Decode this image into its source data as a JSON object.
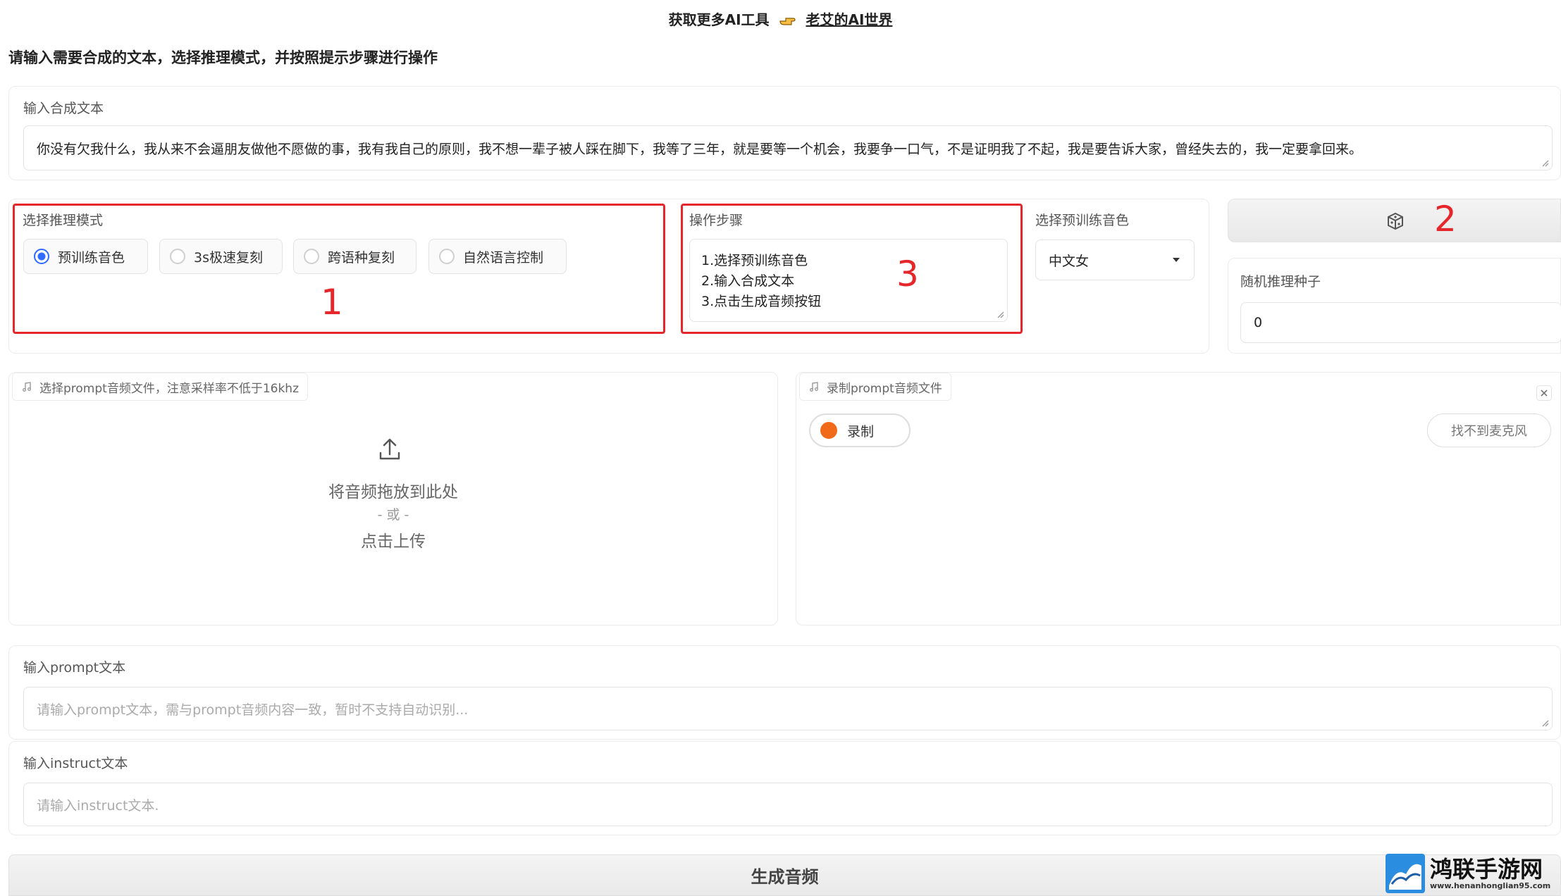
{
  "banner": {
    "prefix": "获取更多AI工具",
    "link": "老艾的AI世界",
    "icon": "pointing-hand-icon"
  },
  "instruction": "请输入需要合成的文本，选择推理模式，并按照提示步骤进行操作",
  "synth_text": {
    "label": "输入合成文本",
    "value": "你没有欠我什么，我从来不会逼朋友做他不愿做的事，我有我自己的原则，我不想一辈子被人踩在脚下，我等了三年，就是要等一个机会，我要争一口气，不是证明我了不起，我是要告诉大家，曾经失去的，我一定要拿回来。"
  },
  "mode": {
    "label": "选择推理模式",
    "options": [
      "预训练音色",
      "3s极速复刻",
      "跨语种复刻",
      "自然语言控制"
    ],
    "selected": "预训练音色"
  },
  "steps": {
    "label": "操作步骤",
    "lines": [
      "1.选择预训练音色",
      "2.输入合成文本",
      "3.点击生成音频按钮"
    ]
  },
  "voice": {
    "label": "选择预训练音色",
    "selected": "中文女"
  },
  "seed": {
    "dice_icon": "dice-icon",
    "label": "随机推理种子",
    "value": "0"
  },
  "annotations": {
    "one": "1",
    "two": "2",
    "three": "3",
    "color": "#e5262a"
  },
  "upload": {
    "tab": "选择prompt音频文件，注意采样率不低于16khz",
    "drop_text": "将音频拖放到此处",
    "or_text": "- 或 -",
    "click_text": "点击上传"
  },
  "record": {
    "tab": "录制prompt音频文件",
    "record_btn": "录制",
    "no_mic_btn": "找不到麦克风"
  },
  "prompt_text": {
    "label": "输入prompt文本",
    "placeholder": "请输入prompt文本，需与prompt音频内容一致，暂时不支持自动识别..."
  },
  "instruct_text": {
    "label": "输入instruct文本",
    "placeholder": "请输入instruct文本."
  },
  "generate_btn": "生成音频",
  "watermark": {
    "name": "鸿联手游网",
    "url": "www.henanhonglian95.com"
  },
  "colors": {
    "accent": "#2f6bff",
    "record": "#f06a1a",
    "annotation": "#e5262a"
  }
}
